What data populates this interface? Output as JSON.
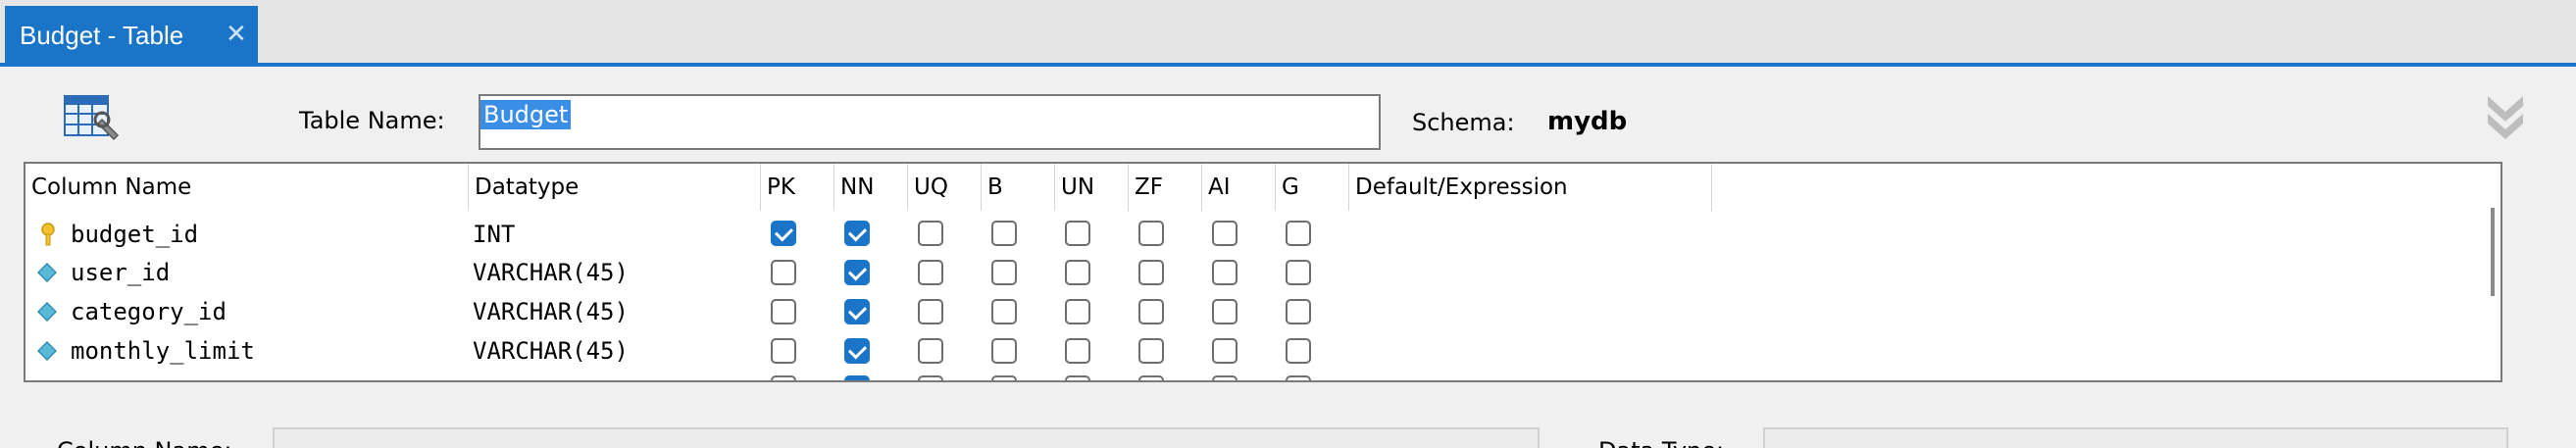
{
  "tab": {
    "label": "Budget - Table",
    "close_glyph": "✕"
  },
  "header": {
    "table_name_label": "Table Name:",
    "table_name_value": "Budget",
    "schema_label": "Schema:",
    "schema_value": "mydb"
  },
  "grid": {
    "columns": [
      "Column Name",
      "Datatype",
      "PK",
      "NN",
      "UQ",
      "B",
      "UN",
      "ZF",
      "AI",
      "G",
      "Default/Expression"
    ],
    "rows": [
      {
        "name": "budget_id",
        "datatype": "INT",
        "icon": "primary-key-icon",
        "flags": [
          true,
          true,
          false,
          false,
          false,
          false,
          false,
          false
        ]
      },
      {
        "name": "user_id",
        "datatype": "VARCHAR(45)",
        "icon": "column-diamond-icon",
        "flags": [
          false,
          true,
          false,
          false,
          false,
          false,
          false,
          false
        ]
      },
      {
        "name": "category_id",
        "datatype": "VARCHAR(45)",
        "icon": "column-diamond-icon",
        "flags": [
          false,
          true,
          false,
          false,
          false,
          false,
          false,
          false
        ]
      },
      {
        "name": "monthly_limit",
        "datatype": "VARCHAR(45)",
        "icon": "column-diamond-icon",
        "flags": [
          false,
          true,
          false,
          false,
          false,
          false,
          false,
          false
        ]
      }
    ]
  },
  "details": {
    "column_name_label": "Column Name:",
    "data_type_label": "Data Type:"
  },
  "colors": {
    "accent": "#1a75c9",
    "selection": "#3a8ee6",
    "key_icon": "#f2c12e",
    "diamond_icon": "#5bb8d6"
  }
}
